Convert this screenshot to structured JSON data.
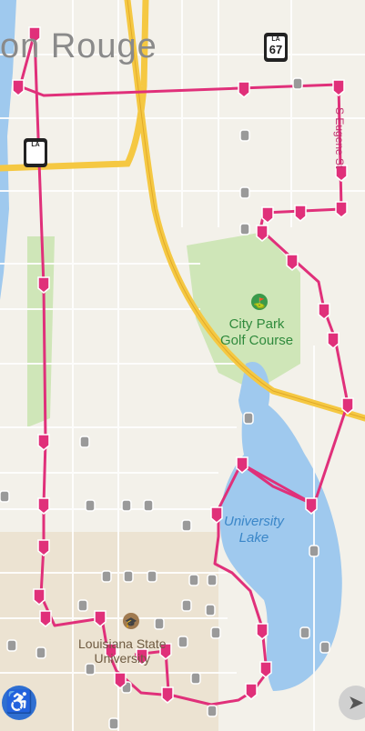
{
  "map": {
    "city_label": "on Rouge",
    "park_label_1": "City Park",
    "park_label_2": "Golf Course",
    "lake_label_1": "University",
    "lake_label_2": "Lake",
    "university_label_1": "Louisiana State",
    "university_label_2": "University",
    "street_label": "S Eugene St",
    "shields": [
      {
        "state": "LA",
        "route": "67"
      },
      {
        "state": "LA",
        "route": ""
      }
    ]
  },
  "colors": {
    "route": "#e0307a",
    "highway": "#f5c842",
    "water": "#9fc9ee",
    "park": "#cfe6b8",
    "campus": "#ece3d2",
    "stop_gray": "#9a9a9a"
  },
  "controls": {
    "accessibility_icon": "wheelchair-icon",
    "location_icon": "location-arrow-icon"
  }
}
